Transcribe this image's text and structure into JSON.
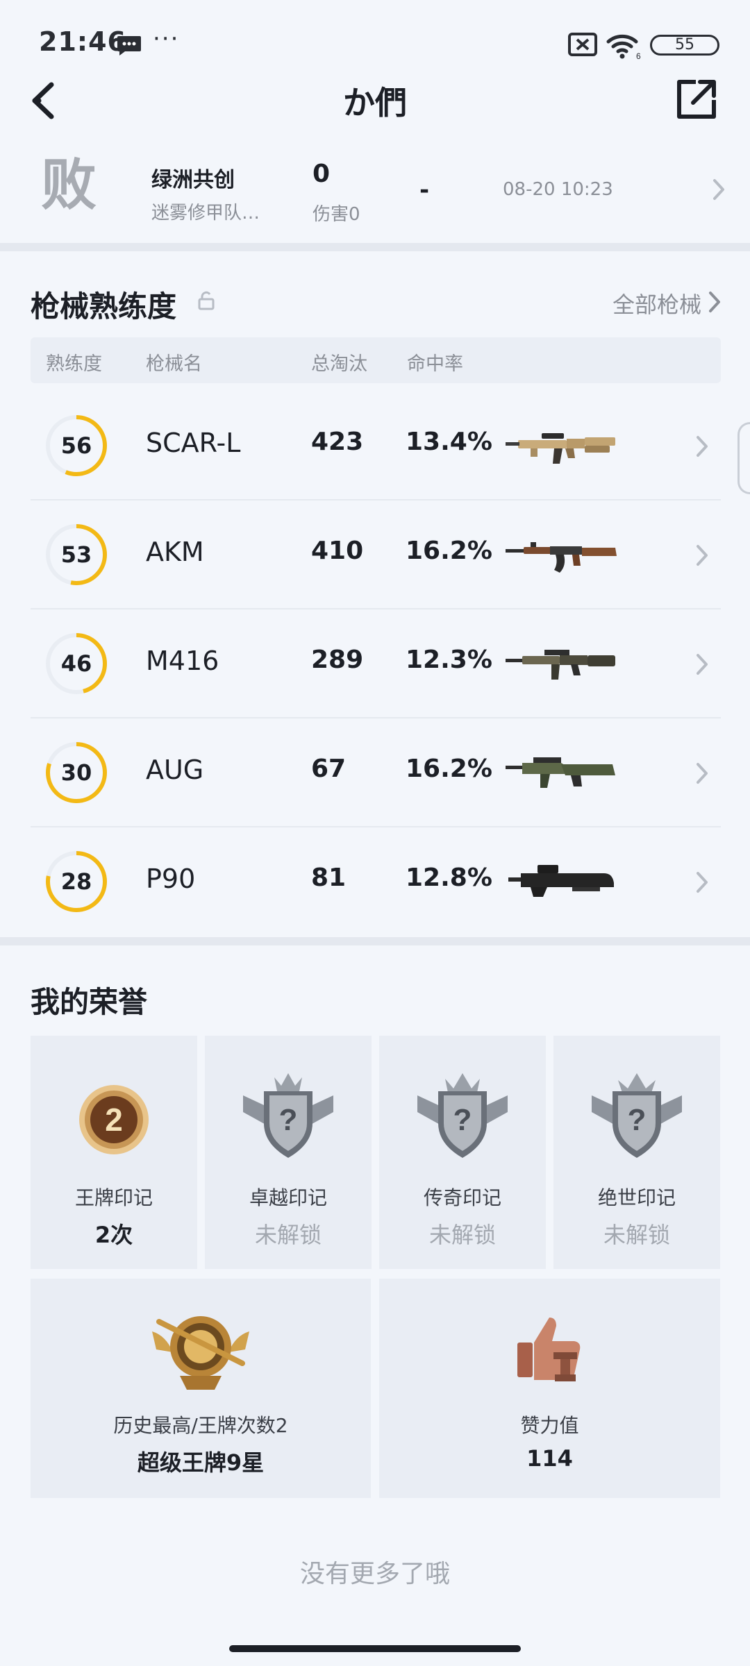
{
  "status_bar": {
    "time": "21:46",
    "dots": "···",
    "battery": "55",
    "wifi_sub": "6"
  },
  "header": {
    "title": "か們"
  },
  "match": {
    "result": "败",
    "mode": "绿洲共创",
    "map": "迷雾修甲队…",
    "kills": "0",
    "damage": "伤害0",
    "rank": "-",
    "time": "08-20 10:23"
  },
  "weapons": {
    "heading": "枪械熟练度",
    "all_link": "全部枪械",
    "columns": [
      "熟练度",
      "枪械名",
      "总淘汰",
      "命中率"
    ],
    "accent_color": "#f3b915",
    "rows": [
      {
        "proficiency": "56",
        "level": 0.56,
        "name": "SCAR-L",
        "kills": "423",
        "accuracy": "13.4%",
        "icon": "scar-l-rifle"
      },
      {
        "proficiency": "53",
        "level": 0.53,
        "name": "AKM",
        "kills": "410",
        "accuracy": "16.2%",
        "icon": "akm-rifle"
      },
      {
        "proficiency": "46",
        "level": 0.46,
        "name": "M416",
        "kills": "289",
        "accuracy": "12.3%",
        "icon": "m416-rifle"
      },
      {
        "proficiency": "30",
        "level": 0.8,
        "name": "AUG",
        "kills": "67",
        "accuracy": "16.2%",
        "icon": "aug-rifle"
      },
      {
        "proficiency": "28",
        "level": 0.78,
        "name": "P90",
        "kills": "81",
        "accuracy": "12.8%",
        "icon": "p90-smg"
      }
    ]
  },
  "honors": {
    "heading": "我的荣誉",
    "badge_number": "2",
    "marks": [
      {
        "label": "王牌印记",
        "value": "2次",
        "locked": false,
        "icon": "ace-mark-medal"
      },
      {
        "label": "卓越印记",
        "value": "未解锁",
        "locked": true,
        "icon": "locked-shield-badge"
      },
      {
        "label": "传奇印记",
        "value": "未解锁",
        "locked": true,
        "icon": "locked-shield-badge"
      },
      {
        "label": "绝世印记",
        "value": "未解锁",
        "locked": true,
        "icon": "locked-shield-badge"
      }
    ],
    "best": {
      "label": "历史最高/王牌次数2",
      "value": "超级王牌9星",
      "icon": "ace-rank-emblem"
    },
    "likes": {
      "label": "赞力值",
      "value": "114",
      "icon": "thumbs-up-trophy"
    }
  },
  "footer": {
    "text": "没有更多了哦"
  }
}
